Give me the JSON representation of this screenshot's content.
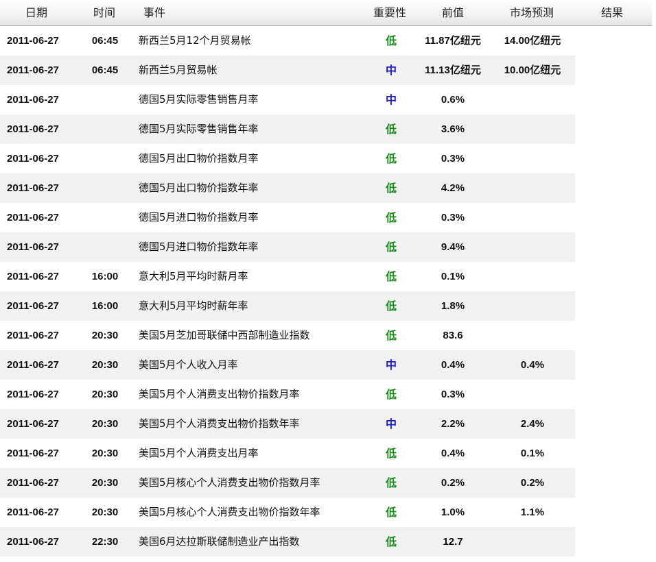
{
  "header": {
    "date": "日期",
    "time": "时间",
    "event": "事件",
    "importance": "重要性",
    "previous": "前值",
    "forecast": "市场预测",
    "result": "结果"
  },
  "colors": {
    "low": "#1a8a1a",
    "mid": "#1a1ac8"
  },
  "rows": [
    {
      "date": "2011-06-27",
      "time": "06:45",
      "event": "新西兰5月12个月贸易帐",
      "importance": "低",
      "level": "low",
      "previous": "11.87亿纽元",
      "forecast": "14.00亿纽元",
      "result": ""
    },
    {
      "date": "2011-06-27",
      "time": "06:45",
      "event": "新西兰5月贸易帐",
      "importance": "中",
      "level": "mid",
      "previous": "11.13亿纽元",
      "forecast": "10.00亿纽元",
      "result": ""
    },
    {
      "date": "2011-06-27",
      "time": "",
      "event": "德国5月实际零售销售月率",
      "importance": "中",
      "level": "mid",
      "previous": "0.6%",
      "forecast": "",
      "result": ""
    },
    {
      "date": "2011-06-27",
      "time": "",
      "event": "德国5月实际零售销售年率",
      "importance": "低",
      "level": "low",
      "previous": "3.6%",
      "forecast": "",
      "result": ""
    },
    {
      "date": "2011-06-27",
      "time": "",
      "event": "德国5月出口物价指数月率",
      "importance": "低",
      "level": "low",
      "previous": "0.3%",
      "forecast": "",
      "result": ""
    },
    {
      "date": "2011-06-27",
      "time": "",
      "event": "德国5月出口物价指数年率",
      "importance": "低",
      "level": "low",
      "previous": "4.2%",
      "forecast": "",
      "result": ""
    },
    {
      "date": "2011-06-27",
      "time": "",
      "event": "德国5月进口物价指数月率",
      "importance": "低",
      "level": "low",
      "previous": "0.3%",
      "forecast": "",
      "result": ""
    },
    {
      "date": "2011-06-27",
      "time": "",
      "event": "德国5月进口物价指数年率",
      "importance": "低",
      "level": "low",
      "previous": "9.4%",
      "forecast": "",
      "result": ""
    },
    {
      "date": "2011-06-27",
      "time": "16:00",
      "event": "意大利5月平均时薪月率",
      "importance": "低",
      "level": "low",
      "previous": "0.1%",
      "forecast": "",
      "result": ""
    },
    {
      "date": "2011-06-27",
      "time": "16:00",
      "event": "意大利5月平均时薪年率",
      "importance": "低",
      "level": "low",
      "previous": "1.8%",
      "forecast": "",
      "result": ""
    },
    {
      "date": "2011-06-27",
      "time": "20:30",
      "event": "美国5月芝加哥联储中西部制造业指数",
      "importance": "低",
      "level": "low",
      "previous": "83.6",
      "forecast": "",
      "result": ""
    },
    {
      "date": "2011-06-27",
      "time": "20:30",
      "event": "美国5月个人收入月率",
      "importance": "中",
      "level": "mid",
      "previous": "0.4%",
      "forecast": "0.4%",
      "result": ""
    },
    {
      "date": "2011-06-27",
      "time": "20:30",
      "event": "美国5月个人消费支出物价指数月率",
      "importance": "低",
      "level": "low",
      "previous": "0.3%",
      "forecast": "",
      "result": ""
    },
    {
      "date": "2011-06-27",
      "time": "20:30",
      "event": "美国5月个人消费支出物价指数年率",
      "importance": "中",
      "level": "mid",
      "previous": "2.2%",
      "forecast": "2.4%",
      "result": ""
    },
    {
      "date": "2011-06-27",
      "time": "20:30",
      "event": "美国5月个人消费支出月率",
      "importance": "低",
      "level": "low",
      "previous": "0.4%",
      "forecast": "0.1%",
      "result": ""
    },
    {
      "date": "2011-06-27",
      "time": "20:30",
      "event": "美国5月核心个人消费支出物价指数月率",
      "importance": "低",
      "level": "low",
      "previous": "0.2%",
      "forecast": "0.2%",
      "result": ""
    },
    {
      "date": "2011-06-27",
      "time": "20:30",
      "event": "美国5月核心个人消费支出物价指数年率",
      "importance": "低",
      "level": "low",
      "previous": "1.0%",
      "forecast": "1.1%",
      "result": ""
    },
    {
      "date": "2011-06-27",
      "time": "22:30",
      "event": "美国6月达拉斯联储制造业产出指数",
      "importance": "低",
      "level": "low",
      "previous": "12.7",
      "forecast": "",
      "result": ""
    }
  ]
}
